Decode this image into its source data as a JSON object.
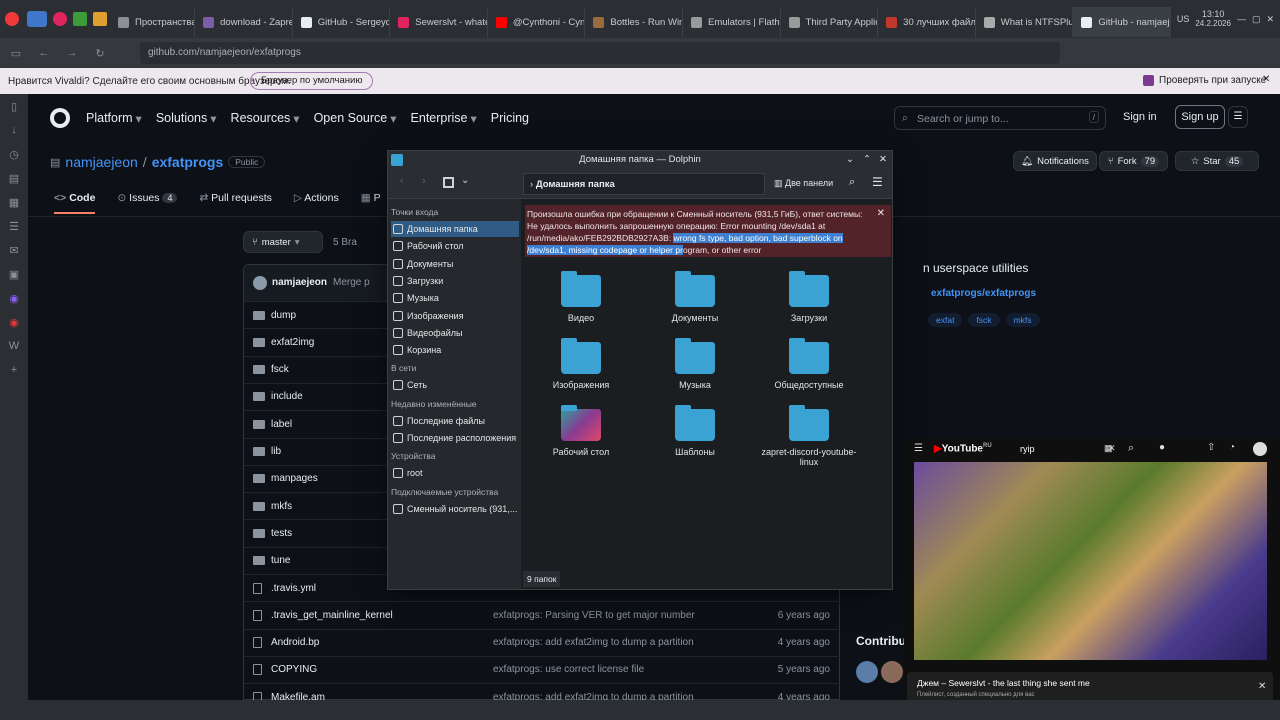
{
  "browser": {
    "tabs": [
      {
        "label": "Пространства",
        "color": "#8a9096"
      },
      {
        "label": "download - Zapret ...",
        "color": "#7b5ea7"
      },
      {
        "label": "GitHub - Sergeydigl...",
        "color": "#e6edf3"
      },
      {
        "label": "Sewerslvt - whatev...",
        "color": "#e0245e"
      },
      {
        "label": "@Cynthoni - Cynth...",
        "color": "#ff0000"
      },
      {
        "label": "Bottles - Run Wind...",
        "color": "#9a6b3c"
      },
      {
        "label": "Emulators | Flathub",
        "color": "#9a9a9a"
      },
      {
        "label": "Third Party Applicat...",
        "color": "#9a9a9a"
      },
      {
        "label": "30 лучших файлов...",
        "color": "#c0392b"
      },
      {
        "label": "What is NTFSPlus a...",
        "color": "#aaa"
      },
      {
        "label": "GitHub - namjaejeon/e...",
        "color": "#e6edf3"
      }
    ],
    "clock_time": "13:10",
    "clock_date": "24.2.2026",
    "keyboard_layout": "US",
    "url": "github.com/namjaejeon/exfatprogs",
    "notice_text": "Нравится Vivaldi? Сделайте его своим основным браузером.",
    "notice_button": "Браузер по умолчанию",
    "notice_check": "Проверять при запуске"
  },
  "github": {
    "nav": [
      "Platform",
      "Solutions",
      "Resources",
      "Open Source",
      "Enterprise",
      "Pricing"
    ],
    "search_placeholder": "Search or jump to...",
    "search_key": "/",
    "sign_in": "Sign in",
    "sign_up": "Sign up",
    "owner": "namjaejeon",
    "repo": "exfatprogs",
    "visibility": "Public",
    "notifications": "Notifications",
    "fork_label": "Fork",
    "fork_count": "79",
    "star_label": "Star",
    "star_count": "45",
    "tabs": {
      "code": "Code",
      "issues": "Issues",
      "issues_count": "4",
      "pulls": "Pull requests",
      "actions": "Actions",
      "projects": "P"
    },
    "branch": "master",
    "branches": "5 Bra",
    "commit_author": "namjaejeon",
    "commit_msg": "Merge p",
    "about": "n userspace utilities",
    "about_link": "exfatprogs/exfatprogs",
    "topics": [
      "exfat",
      "fsck",
      "mkfs"
    ],
    "contrib_heading": "Contribu",
    "files": [
      {
        "name": "dump",
        "type": "dir",
        "msg": "",
        "age": ""
      },
      {
        "name": "exfat2img",
        "type": "dir",
        "msg": "",
        "age": ""
      },
      {
        "name": "fsck",
        "type": "dir",
        "msg": "",
        "age": ""
      },
      {
        "name": "include",
        "type": "dir",
        "msg": "",
        "age": ""
      },
      {
        "name": "label",
        "type": "dir",
        "msg": "",
        "age": ""
      },
      {
        "name": "lib",
        "type": "dir",
        "msg": "",
        "age": ""
      },
      {
        "name": "manpages",
        "type": "dir",
        "msg": "",
        "age": ""
      },
      {
        "name": "mkfs",
        "type": "dir",
        "msg": "",
        "age": ""
      },
      {
        "name": "tests",
        "type": "dir",
        "msg": "",
        "age": ""
      },
      {
        "name": "tune",
        "type": "dir",
        "msg": "",
        "age": ""
      },
      {
        "name": ".travis.yml",
        "type": "file",
        "msg": "",
        "age": ""
      },
      {
        "name": ".travis_get_mainline_kernel",
        "type": "file",
        "msg": "exfatprogs: Parsing VER to get major number",
        "age": "6 years ago"
      },
      {
        "name": "Android.bp",
        "type": "file",
        "msg": "exfatprogs: add exfat2img to dump a partition",
        "age": "4 years ago"
      },
      {
        "name": "COPYING",
        "type": "file",
        "msg": "exfatprogs: use correct license file",
        "age": "5 years ago"
      },
      {
        "name": "Makefile.am",
        "type": "file",
        "msg": "exfatprogs: add exfat2img to dump a partition",
        "age": "4 years ago"
      }
    ]
  },
  "dolphin": {
    "title": "Домашняя папка — Dolphin",
    "location": "Домашняя папка",
    "split_label": "Две панели",
    "error_plain": "Произошла ошибка при обращении к Сменный носитель (931,5 ГиБ), ответ системы: Не удалось выполнить запрошенную операцию: Error mounting /dev/sda1 at /run/media/ako/FEB292BDB2927A3B: ",
    "error_sel": "wrong fs type, bad option, bad superblock on /dev/sda1, missing codepage or helper pr",
    "error_tail": "ogram, or other error",
    "sidebar": {
      "places_heading": "Точки входа",
      "places": [
        "Домашняя папка",
        "Рабочий стол",
        "Документы",
        "Загрузки",
        "Музыка",
        "Изображения",
        "Видеофайлы",
        "Корзина"
      ],
      "net_heading": "В сети",
      "net": [
        "Сеть"
      ],
      "recent_heading": "Недавно изменённые",
      "recent": [
        "Последние файлы",
        "Последние расположения"
      ],
      "devices_heading": "Устройства",
      "devices": [
        "root"
      ],
      "removable_heading": "Подключаемые устройства",
      "removable": [
        "Сменный носитель (931,..."
      ]
    },
    "folders": [
      "Видео",
      "Документы",
      "Загрузки",
      "Изображения",
      "Музыка",
      "Общедоступные",
      "Рабочий стол",
      "Шаблоны",
      "zapret-discord-youtube-linux"
    ],
    "status": "9 папок"
  },
  "youtube": {
    "logo": "YouTube",
    "logo_badge": "RU",
    "search": "ryip",
    "now_playing": "Джем – Sewerslvt - the last thing she sent me",
    "playlist_note": "Плейлист, созданный специально для вас"
  }
}
